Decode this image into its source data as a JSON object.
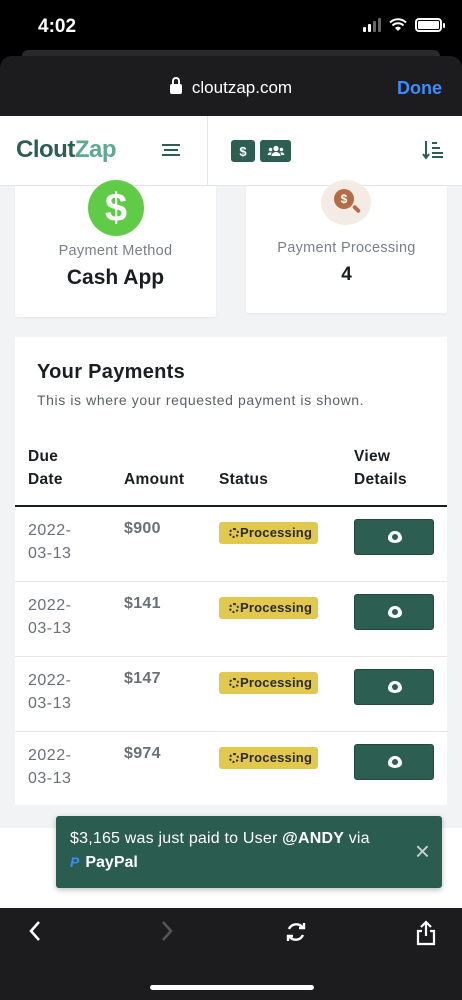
{
  "status_bar": {
    "time": "4:02"
  },
  "browser": {
    "url": "cloutzap.com",
    "done_label": "Done"
  },
  "header": {
    "logo_part1": "Clout",
    "logo_part2": "Zap",
    "dollar_btn": "$",
    "users_btn": "👥",
    "accent_color": "#2d5e52"
  },
  "cards": {
    "method": {
      "icon": "$",
      "label": "Payment Method",
      "value": "Cash App"
    },
    "processing": {
      "icon": "$",
      "label": "Payment Processing",
      "value": "4"
    }
  },
  "payments": {
    "title": "Your Payments",
    "subtitle": "This is where your requested payment is shown.",
    "columns": {
      "due_date": "Due Date",
      "amount": "Amount",
      "status": "Status",
      "view": "View Details"
    },
    "rows": [
      {
        "date": "2022-03-13",
        "amount": "$900",
        "status": "Processing"
      },
      {
        "date": "2022-03-13",
        "amount": "$141",
        "status": "Processing"
      },
      {
        "date": "2022-03-13",
        "amount": "$147",
        "status": "Processing"
      },
      {
        "date": "2022-03-13",
        "amount": "$974",
        "status": "Processing"
      }
    ]
  },
  "toast": {
    "text": "$3,165 was just paid to User ",
    "user": "@ANDY",
    "via": " via",
    "method": "PayPal",
    "close": "×"
  },
  "bottom_bar": {
    "back": "‹",
    "forward": "›",
    "reload": "⟳",
    "share": "⇪"
  }
}
